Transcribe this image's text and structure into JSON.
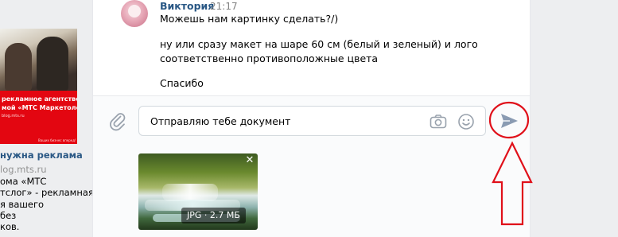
{
  "ad": {
    "banner_line1": "рекламное агентство",
    "banner_line2": "мой «МТС Маркетолог»",
    "banner_line3": "blog.mts.ru",
    "banner_line4": "Ваших бизнес вперед!",
    "title": "нужна реклама",
    "domain": "log.mts.ru",
    "desc_lines": [
      "ома «МТС",
      "тслог» - рекламная",
      "я вашего",
      "без",
      "ков."
    ]
  },
  "message": {
    "author": "Виктория",
    "time": "21:17",
    "lines": [
      "Можешь нам картинку сделать?/)",
      "ну или сразу макет на шаре 60 см (белый и зеленый) и лого",
      "соответственно противоположные цвета",
      "Спасибо"
    ]
  },
  "composer": {
    "input_value": "Отправляю тебе документ",
    "attachment_label": "JPG · 2.7 МБ",
    "close_glyph": "✕"
  },
  "icons": {
    "attach": "paperclip-icon",
    "camera": "camera-icon",
    "emoji": "smile-icon",
    "send": "send-icon"
  },
  "colors": {
    "link_blue": "#2a5885",
    "send_icon": "#8a9bb2",
    "annotation_red": "#e0101a",
    "mts_red": "#e30611"
  }
}
